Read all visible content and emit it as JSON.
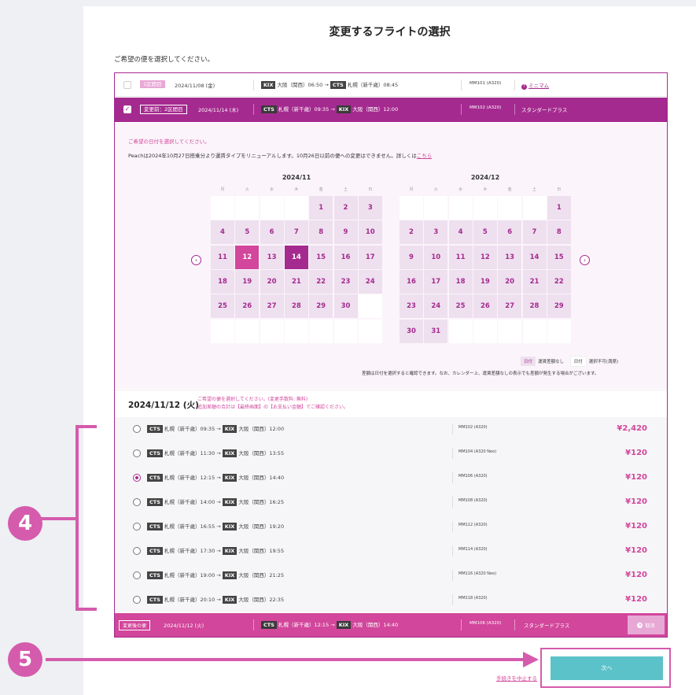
{
  "page": {
    "title": "変更するフライトの選択",
    "subtitle": "ご希望の便を選択してください。"
  },
  "segments": [
    {
      "badge": "1区間目",
      "date": "2024/11/08 (金)",
      "from_code": "KIX",
      "from_text": "大阪（関西）06:50",
      "to_code": "CTS",
      "to_text": "札幌（新千歳）08:45",
      "flight": "MM101 (A320)",
      "fare": "ミニマム",
      "checked": false
    },
    {
      "badge": "変更前：2区間目",
      "date": "2024/11/14 (木)",
      "from_code": "CTS",
      "from_text": "札幌（新千歳）09:35",
      "to_code": "KIX",
      "to_text": "大阪（関西）12:00",
      "flight": "MM102 (A320)",
      "fare": "スタンダードプラス",
      "checked": true
    }
  ],
  "notice": {
    "date_prompt": "ご希望の日付を選択してください。",
    "info": "Peachは2024年10月27日搭乗分より運賃タイプをリニューアルします。10月26日以前の便への変更はできません。詳しくは",
    "link": "こちら"
  },
  "calendar": {
    "weekdays": [
      "月",
      "火",
      "水",
      "木",
      "金",
      "土",
      "日"
    ],
    "months": [
      {
        "title": "2024/11",
        "weeks": [
          [
            "",
            "",
            "",
            "",
            "1",
            "2",
            "3"
          ],
          [
            "4",
            "5",
            "6",
            "7",
            "8",
            "9",
            "10"
          ],
          [
            "11",
            "12",
            "13",
            "14",
            "15",
            "16",
            "17"
          ],
          [
            "18",
            "19",
            "20",
            "21",
            "22",
            "23",
            "24"
          ],
          [
            "25",
            "26",
            "27",
            "28",
            "29",
            "30",
            ""
          ],
          [
            "",
            "",
            "",
            "",
            "",
            "",
            ""
          ]
        ]
      },
      {
        "title": "2024/12",
        "weeks": [
          [
            "",
            "",
            "",
            "",
            "",
            "",
            "1"
          ],
          [
            "2",
            "3",
            "4",
            "5",
            "6",
            "7",
            "8"
          ],
          [
            "9",
            "10",
            "11",
            "12",
            "13",
            "14",
            "15"
          ],
          [
            "16",
            "17",
            "18",
            "19",
            "20",
            "21",
            "22"
          ],
          [
            "23",
            "24",
            "25",
            "26",
            "27",
            "28",
            "29"
          ],
          [
            "30",
            "31",
            "",
            "",
            "",
            "",
            ""
          ]
        ]
      }
    ],
    "selected_new": "12",
    "selected_current": "14",
    "prev_icon": "chevron-left-icon",
    "next_icon": "chevron-right-icon",
    "legend": {
      "avail_box": "日付",
      "avail_label": "運賃差額なし",
      "na_box": "日付",
      "na_label": "選択不可(満席)"
    },
    "legend_note": "差額は日付を選択すると確認できます。なお、カレンダー上、運賃差額なしの表示でも差額が発生する場合がございます。"
  },
  "options_header": {
    "date": "2024/11/12 (火)",
    "note_line1": "ご希望の便を選択してください。(変更手数料: 無料)",
    "note_line2": "追加差額の合計は【最終画面】の【お支払い金額】でご確認ください。"
  },
  "options": [
    {
      "from_code": "CTS",
      "from_text": "札幌（新千歳）09:35",
      "to_code": "KIX",
      "to_text": "大阪（関西）12:00",
      "flight": "MM102 (A320)",
      "price": "¥2,420",
      "selected": false
    },
    {
      "from_code": "CTS",
      "from_text": "札幌（新千歳）11:30",
      "to_code": "KIX",
      "to_text": "大阪（関西）13:55",
      "flight": "MM104 (A320 Neo)",
      "price": "¥120",
      "selected": false
    },
    {
      "from_code": "CTS",
      "from_text": "札幌（新千歳）12:15",
      "to_code": "KIX",
      "to_text": "大阪（関西）14:40",
      "flight": "MM106 (A320)",
      "price": "¥120",
      "selected": true
    },
    {
      "from_code": "CTS",
      "from_text": "札幌（新千歳）14:00",
      "to_code": "KIX",
      "to_text": "大阪（関西）16:25",
      "flight": "MM108 (A320)",
      "price": "¥120",
      "selected": false
    },
    {
      "from_code": "CTS",
      "from_text": "札幌（新千歳）16:55",
      "to_code": "KIX",
      "to_text": "大阪（関西）19:20",
      "flight": "MM112 (A320)",
      "price": "¥120",
      "selected": false
    },
    {
      "from_code": "CTS",
      "from_text": "札幌（新千歳）17:30",
      "to_code": "KIX",
      "to_text": "大阪（関西）19:55",
      "flight": "MM114 (A320)",
      "price": "¥120",
      "selected": false
    },
    {
      "from_code": "CTS",
      "from_text": "札幌（新千歳）19:00",
      "to_code": "KIX",
      "to_text": "大阪（関西）21:25",
      "flight": "MM116 (A320 Neo)",
      "price": "¥120",
      "selected": false
    },
    {
      "from_code": "CTS",
      "from_text": "札幌（新千歳）20:10",
      "to_code": "KIX",
      "to_text": "大阪（関西）22:35",
      "flight": "MM118 (A320)",
      "price": "¥120",
      "selected": false
    }
  ],
  "result": {
    "badge": "変更後の便",
    "date": "2024/11/12 (火)",
    "from_code": "CTS",
    "from_text": "札幌（新千歳）12:15",
    "to_code": "KIX",
    "to_text": "大阪（関西）14:40",
    "flight": "MM106 (A320)",
    "fare": "スタンダードプラス",
    "cancel_label": "取消"
  },
  "actions": {
    "next_label": "次へ",
    "abort_label": "手続きを中止する"
  },
  "annotations": {
    "step4": "4",
    "step5": "5"
  },
  "colors": {
    "brand_purple": "#a52a8f",
    "brand_pink": "#d2469b",
    "annotation_pink": "#d55bad",
    "next_button": "#5cc2ca"
  }
}
